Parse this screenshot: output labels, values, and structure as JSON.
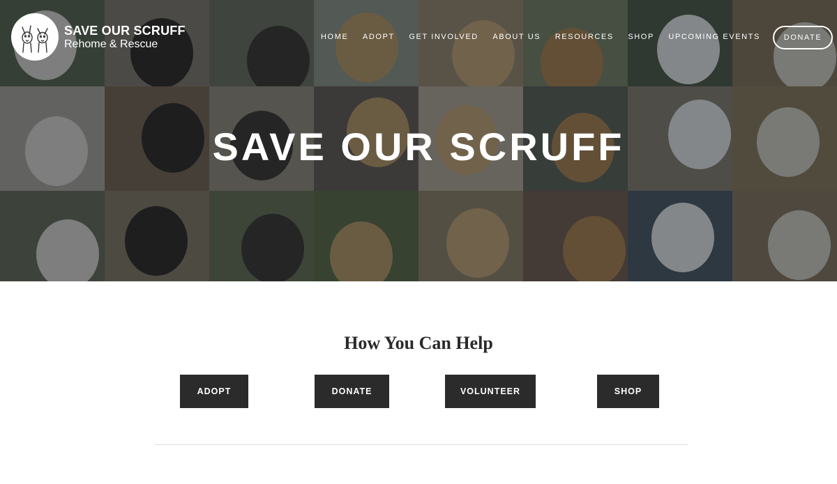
{
  "brand": {
    "title": "SAVE OUR SCRUFF",
    "subtitle": "Rehome & Rescue",
    "logo_icon": "dogs-logo-icon"
  },
  "nav": {
    "items": [
      "HOME",
      "ADOPT",
      "GET INVOLVED",
      "ABOUT US",
      "RESOURCES",
      "SHOP",
      "UPCOMING EVENTS"
    ],
    "donate_label": "DONATE"
  },
  "hero": {
    "title": "SAVE OUR SCRUFF",
    "image_description_icon": "dog-photo-collage"
  },
  "help": {
    "title": "How You Can Help",
    "buttons": [
      "ADOPT",
      "DONATE",
      "VOLUNTEER",
      "SHOP"
    ]
  },
  "colors": {
    "button_bg": "#2b2b2b",
    "overlay": "#14181c",
    "text_dark": "#2a2a2a"
  }
}
